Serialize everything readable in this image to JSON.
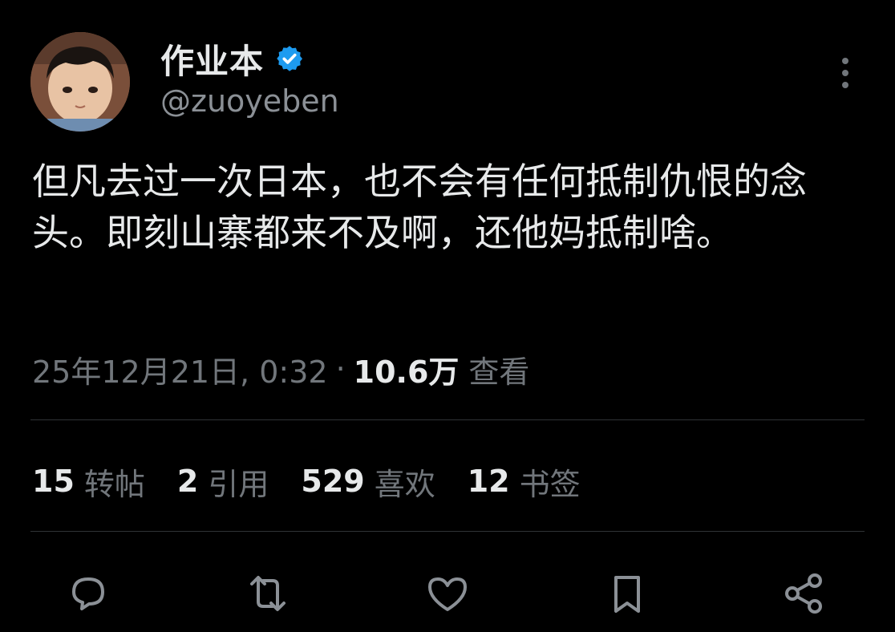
{
  "author": {
    "display_name": "作业本",
    "handle": "@zuoyeben",
    "verified": true
  },
  "tweet": {
    "text": "但凡去过一次日本，也不会有任何抵制仇恨的念头。即刻山寨都来不及啊，还他妈抵制啥。",
    "timestamp": "25年12月21日, 0:32",
    "separator": "·",
    "views_count": "10.6万",
    "views_label": "查看"
  },
  "stats": [
    {
      "count": "15",
      "label": "转帖"
    },
    {
      "count": "2",
      "label": "引用"
    },
    {
      "count": "529",
      "label": "喜欢"
    },
    {
      "count": "12",
      "label": "书签"
    }
  ],
  "actions": [
    "reply-icon",
    "repost-icon",
    "like-icon",
    "bookmark-icon",
    "share-icon"
  ],
  "colors": {
    "background": "#000000",
    "text": "#e7e9ea",
    "muted": "#71767b",
    "verified": "#1d9bf0",
    "divider": "#2f3336"
  }
}
